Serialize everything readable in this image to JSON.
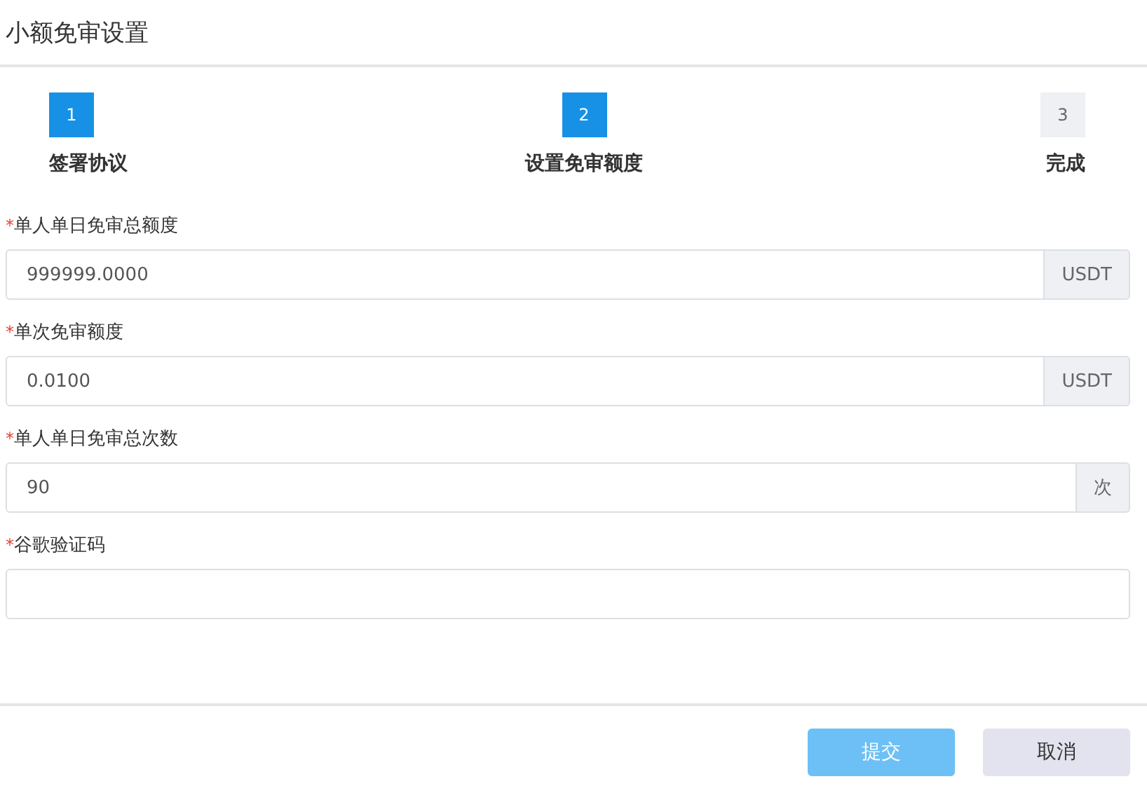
{
  "dialog": {
    "title": "小额免审设置"
  },
  "steps": [
    {
      "number": "1",
      "label": "签署协议",
      "done": true
    },
    {
      "number": "2",
      "label": "设置免审额度",
      "done": true
    },
    {
      "number": "3",
      "label": "完成",
      "done": false
    }
  ],
  "fields": [
    {
      "mark": "*",
      "label": "单人单日免审总额度",
      "value": "999999.0000",
      "suffix": "USDT"
    },
    {
      "mark": "*",
      "label": "单次免审额度",
      "value": "0.0100",
      "suffix": "USDT"
    },
    {
      "mark": "*",
      "label": "单人单日免审总次数",
      "value": "90",
      "suffix": "次"
    },
    {
      "mark": "*",
      "label": "谷歌验证码"
    }
  ],
  "buttons": [
    {
      "label": "提交",
      "kind": "primary",
      "disabled": true
    },
    {
      "label": "取消",
      "kind": "secondary",
      "disabled": false
    }
  ]
}
